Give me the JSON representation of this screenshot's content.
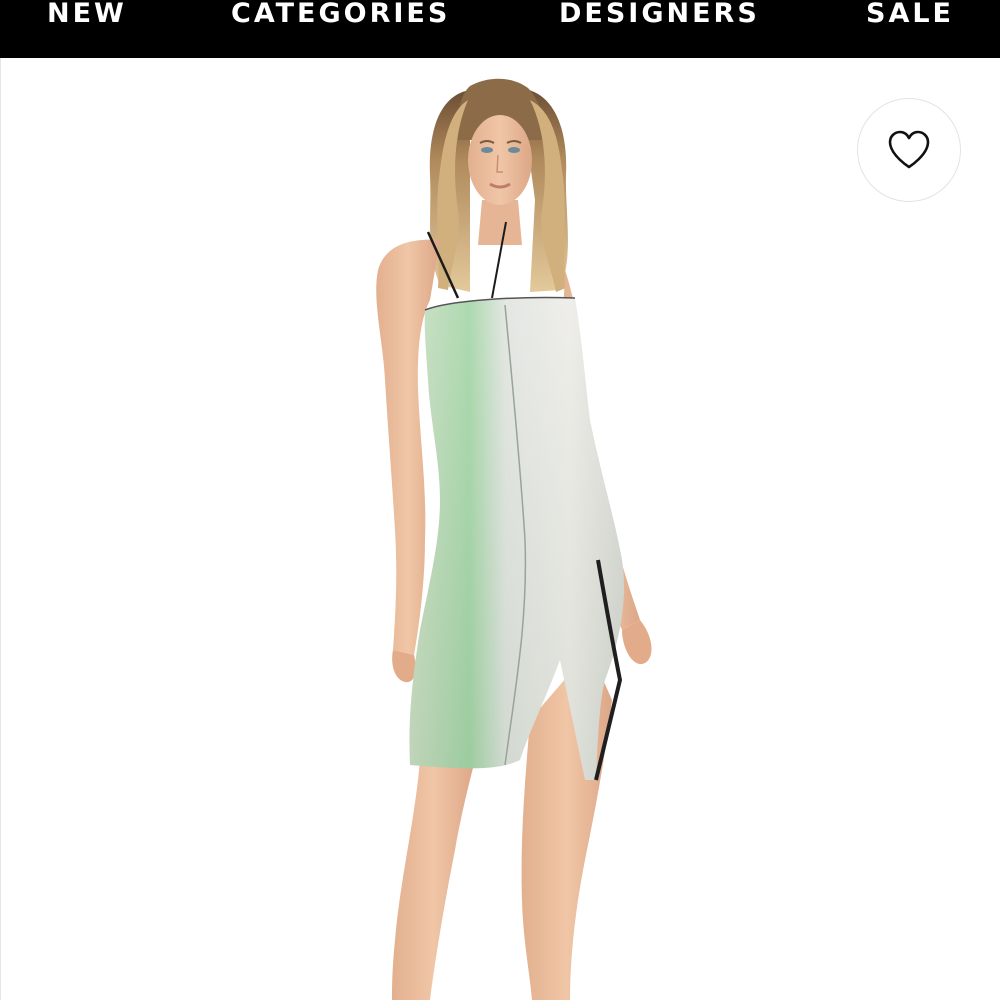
{
  "nav": {
    "items": [
      {
        "label": "NEW"
      },
      {
        "label": "CATEGORIES"
      },
      {
        "label": "DESIGNERS"
      },
      {
        "label": "SALE"
      }
    ]
  },
  "favorite": {
    "icon": "heart-icon"
  },
  "product": {
    "image": "product-photo-model-in-sequin-slip-dress"
  },
  "colors": {
    "nav_background": "#000000",
    "nav_text": "#ffffff",
    "page_background": "#ffffff"
  }
}
